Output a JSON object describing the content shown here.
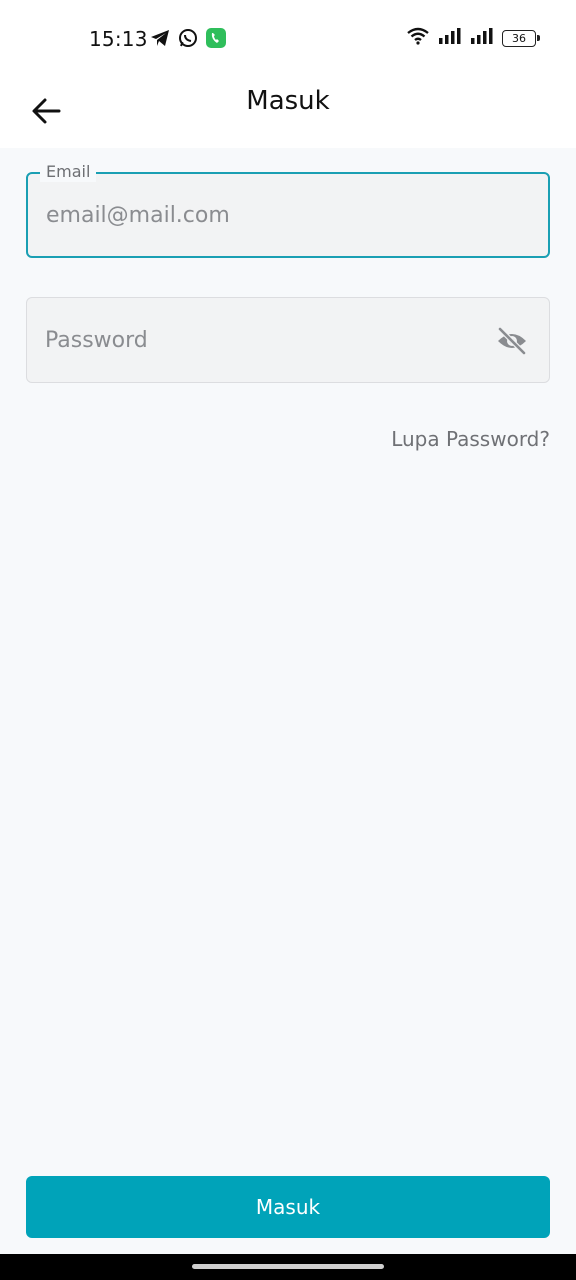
{
  "status_bar": {
    "time": "15:13",
    "battery": "36",
    "left_icons": [
      "telegram-icon",
      "whatsapp-icon",
      "phone-call-icon"
    ],
    "right_icons": [
      "wifi-icon",
      "signal-icon",
      "signal-icon",
      "battery-icon"
    ]
  },
  "header": {
    "title": "Masuk",
    "back_icon": "arrow-left-icon"
  },
  "form": {
    "email": {
      "label": "Email",
      "placeholder": "email@mail.com",
      "value": ""
    },
    "password": {
      "placeholder": "Password",
      "value": "",
      "visibility_icon": "eye-off-icon"
    },
    "forgot_label": "Lupa Password?"
  },
  "footer": {
    "submit_label": "Masuk"
  },
  "colors": {
    "accent": "#00a3b9",
    "focus_border": "#1a9fb3",
    "background": "#f7f9fb",
    "field_background": "#f2f3f4"
  }
}
